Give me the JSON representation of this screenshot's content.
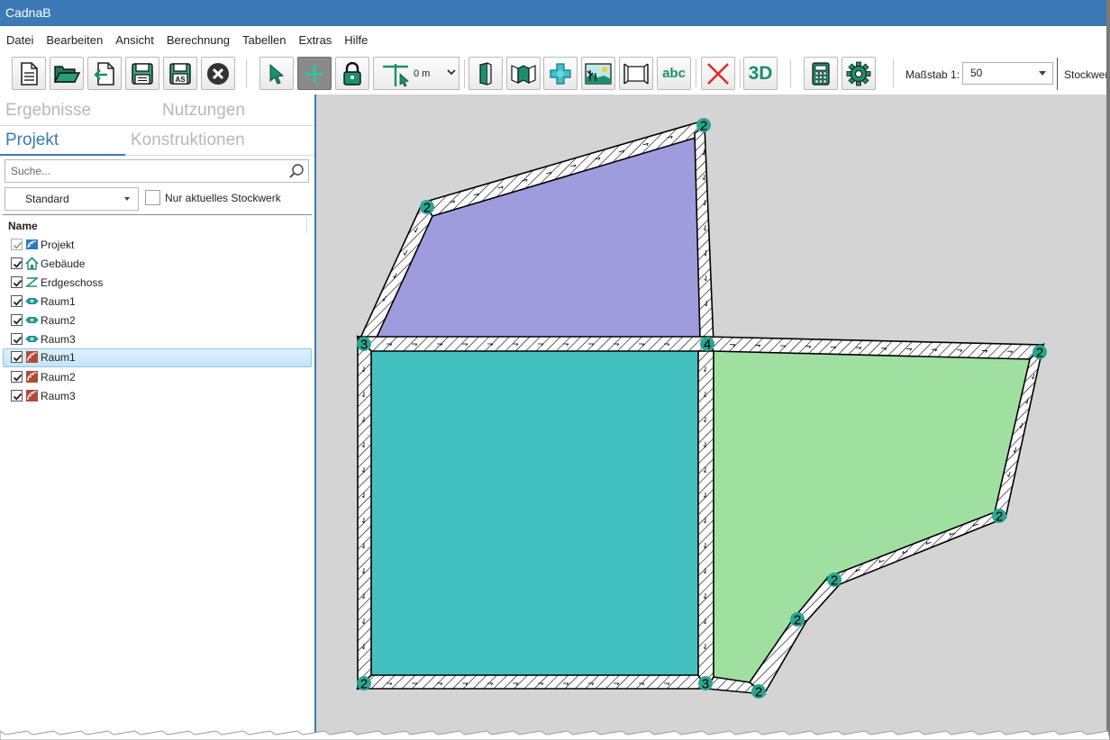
{
  "app": {
    "title": "CadnaB"
  },
  "menu": {
    "items": [
      "Datei",
      "Bearbeiten",
      "Ansicht",
      "Berechnung",
      "Tabellen",
      "Extras",
      "Hilfe"
    ]
  },
  "toolbar": {
    "snap_distance": "0 m",
    "abc_label": "abc",
    "view3d_label": "3D",
    "scale_label": "Maßstab 1:",
    "scale_value": "50",
    "storey_label": "Stockwerk"
  },
  "left_panel": {
    "tabs": [
      "Ergebnisse",
      "Nutzungen",
      "Projekt",
      "Konstruktionen"
    ],
    "active_tab": "Projekt",
    "search_placeholder": "Suche...",
    "view_select": "Standard",
    "current_storey_only_label": "Nur aktuelles Stockwerk",
    "current_storey_only_checked": false,
    "tree_header": "Name",
    "tree": [
      {
        "label": "Projekt",
        "icon": "project-icon",
        "checked": true,
        "disabled": true
      },
      {
        "label": "Gebäude",
        "icon": "building-icon",
        "checked": true
      },
      {
        "label": "Erdgeschoss",
        "icon": "storey-icon",
        "checked": true
      },
      {
        "label": "Raum1",
        "icon": "room-usage-icon",
        "checked": true
      },
      {
        "label": "Raum2",
        "icon": "room-usage-icon",
        "checked": true
      },
      {
        "label": "Raum3",
        "icon": "room-usage-icon",
        "checked": true
      },
      {
        "label": "Raum1",
        "icon": "room-construction-icon",
        "checked": true,
        "selected": true
      },
      {
        "label": "Raum2",
        "icon": "room-construction-icon",
        "checked": true
      },
      {
        "label": "Raum3",
        "icon": "room-construction-icon",
        "checked": true
      }
    ]
  },
  "canvas": {
    "room_colors": {
      "purple": "#9e9cdd",
      "teal": "#42c1c0",
      "green": "#9fe0a1"
    },
    "wall_colors": {
      "fill": "#ffffff",
      "outline": "#000000"
    },
    "node_color": "#2aa58f",
    "node_labels": [
      "2",
      "2",
      "3",
      "4",
      "2",
      "2",
      "2",
      "2",
      "2",
      "3",
      "2"
    ]
  },
  "colors": {
    "accent": "#3b7ab4",
    "canvas_bg": "#d4d4d4"
  }
}
